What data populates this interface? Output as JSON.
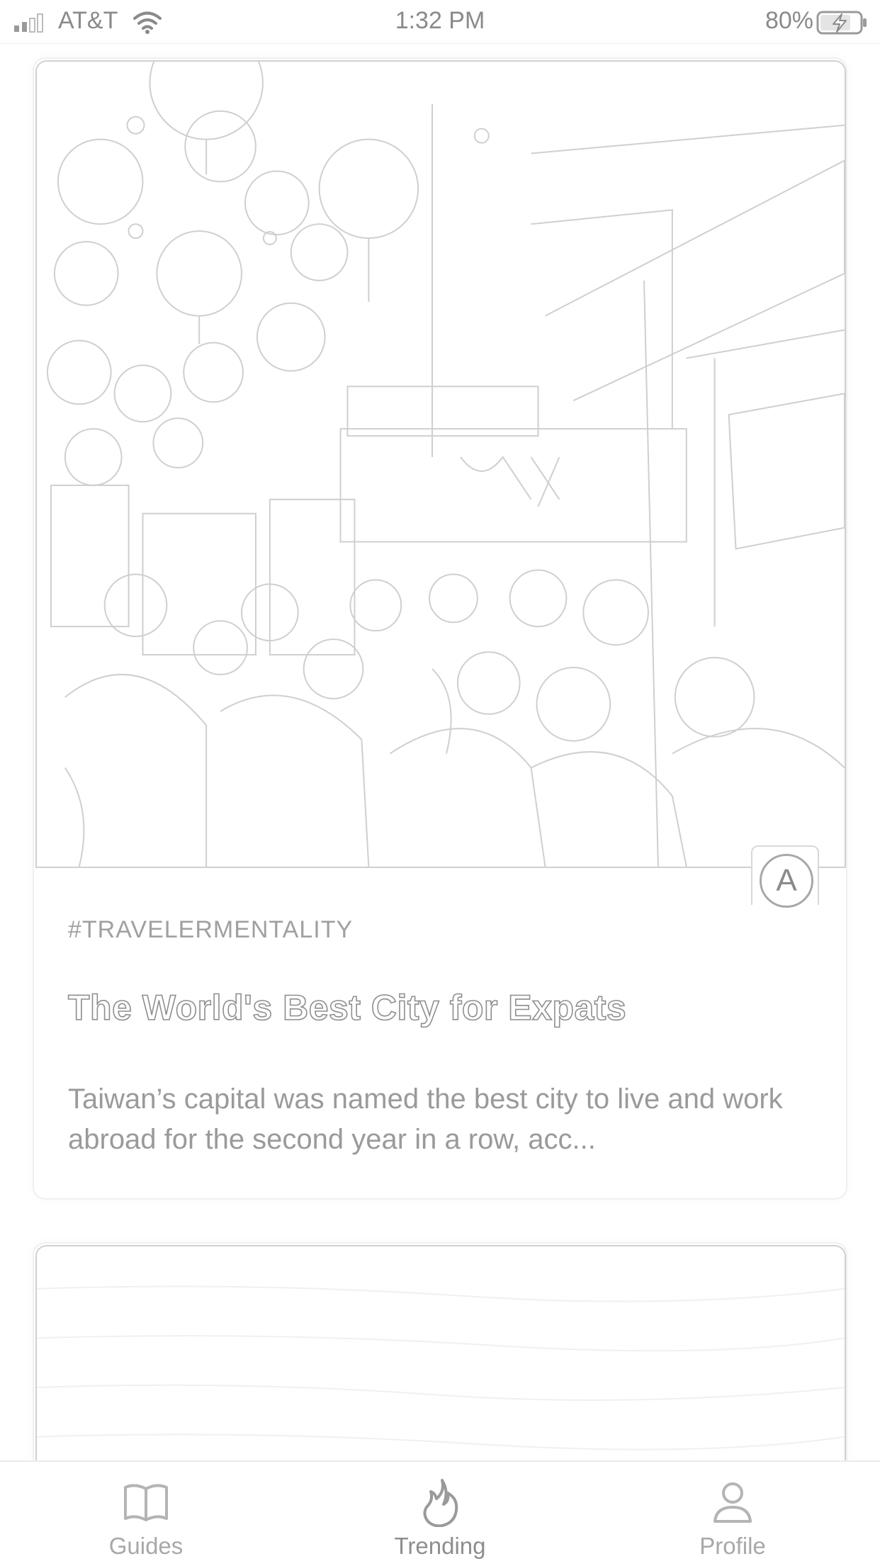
{
  "status_bar": {
    "carrier": "AT&T",
    "time": "1:32 PM",
    "battery_percent": "80%",
    "icons": [
      "signal-icon",
      "wifi-icon",
      "battery-charging-icon"
    ]
  },
  "feed": {
    "cards": [
      {
        "image": "market-street-lanterns-photo",
        "source_badge": "A",
        "tag": "#TRAVELERMENTALITY",
        "title": "The World's Best City for Expats",
        "excerpt": " Taiwan’s capital was named the best city to live and work abroad for the second year in a row, acc..."
      },
      {
        "image": "wood-texture-photo"
      }
    ]
  },
  "tab_bar": {
    "active": "Trending",
    "tabs": [
      {
        "label": "Guides",
        "icon": "book-icon"
      },
      {
        "label": "Trending",
        "icon": "flame-icon"
      },
      {
        "label": "Profile",
        "icon": "person-icon"
      }
    ]
  },
  "colors": {
    "background": "#ffffff",
    "text": "#9a9a9a",
    "border": "#d0d0d0"
  }
}
